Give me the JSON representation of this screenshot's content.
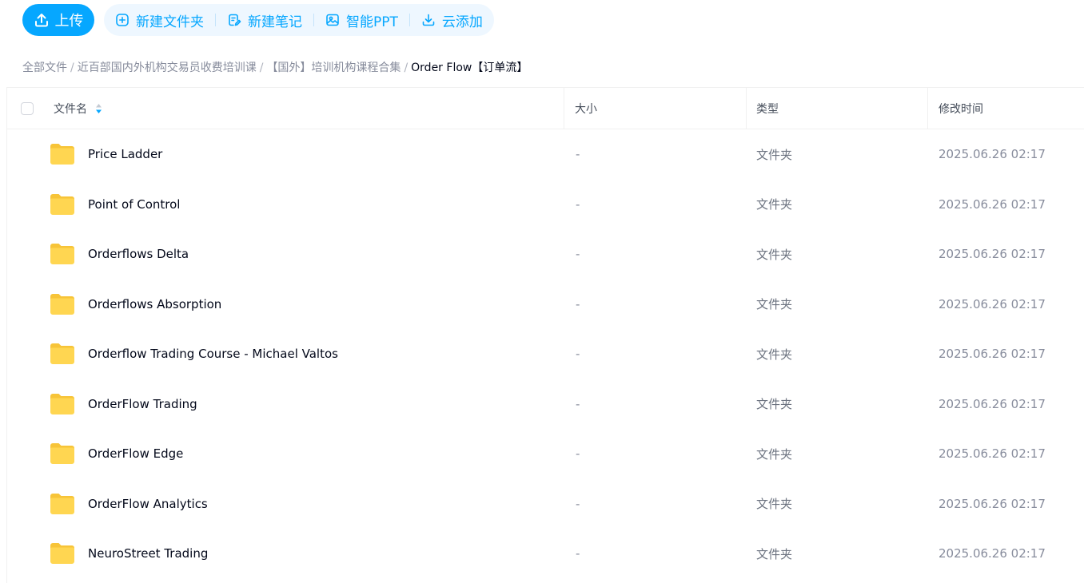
{
  "toolbar": {
    "upload_label": "上传",
    "new_folder_label": "新建文件夹",
    "new_note_label": "新建笔记",
    "smart_ppt_label": "智能PPT",
    "cloud_add_label": "云添加",
    "accent_color": "#06a7ff"
  },
  "breadcrumb": {
    "items": [
      "全部文件",
      "近百部国内外机构交易员收费培训课",
      "【国外】培训机构课程合集"
    ],
    "current": "Order Flow【订单流】"
  },
  "table": {
    "headers": {
      "name": "文件名",
      "size": "大小",
      "type": "类型",
      "modified": "修改时间"
    },
    "rows": [
      {
        "name": "Price Ladder",
        "size": "-",
        "type": "文件夹",
        "modified": "2025.06.26 02:17",
        "icon": "folder-icon"
      },
      {
        "name": "Point of Control",
        "size": "-",
        "type": "文件夹",
        "modified": "2025.06.26 02:17",
        "icon": "folder-icon"
      },
      {
        "name": "Orderflows Delta",
        "size": "-",
        "type": "文件夹",
        "modified": "2025.06.26 02:17",
        "icon": "folder-icon"
      },
      {
        "name": "Orderflows Absorption",
        "size": "-",
        "type": "文件夹",
        "modified": "2025.06.26 02:17",
        "icon": "folder-icon"
      },
      {
        "name": "Orderflow Trading Course - Michael Valtos",
        "size": "-",
        "type": "文件夹",
        "modified": "2025.06.26 02:17",
        "icon": "folder-icon"
      },
      {
        "name": "OrderFlow Trading",
        "size": "-",
        "type": "文件夹",
        "modified": "2025.06.26 02:17",
        "icon": "folder-icon"
      },
      {
        "name": "OrderFlow Edge",
        "size": "-",
        "type": "文件夹",
        "modified": "2025.06.26 02:17",
        "icon": "folder-icon"
      },
      {
        "name": "OrderFlow Analytics",
        "size": "-",
        "type": "文件夹",
        "modified": "2025.06.26 02:17",
        "icon": "folder-icon"
      },
      {
        "name": "NeuroStreet Trading",
        "size": "-",
        "type": "文件夹",
        "modified": "2025.06.26 02:17",
        "icon": "folder-icon"
      }
    ]
  }
}
